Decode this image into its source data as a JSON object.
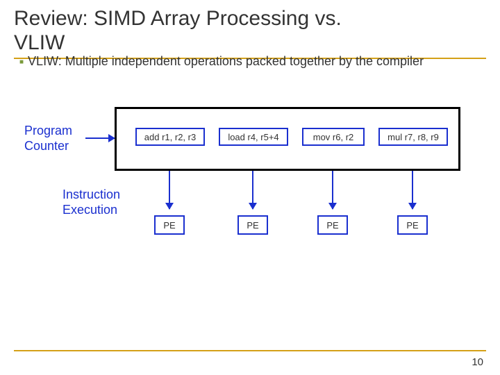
{
  "title_line1": "Review: SIMD Array Processing vs.",
  "title_line2": "VLIW",
  "bullet": "VLIW: Multiple independent operations packed together by the compiler",
  "labels": {
    "program": "Program",
    "counter": "Counter",
    "instruction": "Instruction",
    "execution": "Execution"
  },
  "ops": {
    "op1": "add r1, r2, r3",
    "op2": "load r4, r5+4",
    "op3": "mov r6, r2",
    "op4": "mul r7, r8, r9"
  },
  "pe": "PE",
  "page": "10"
}
